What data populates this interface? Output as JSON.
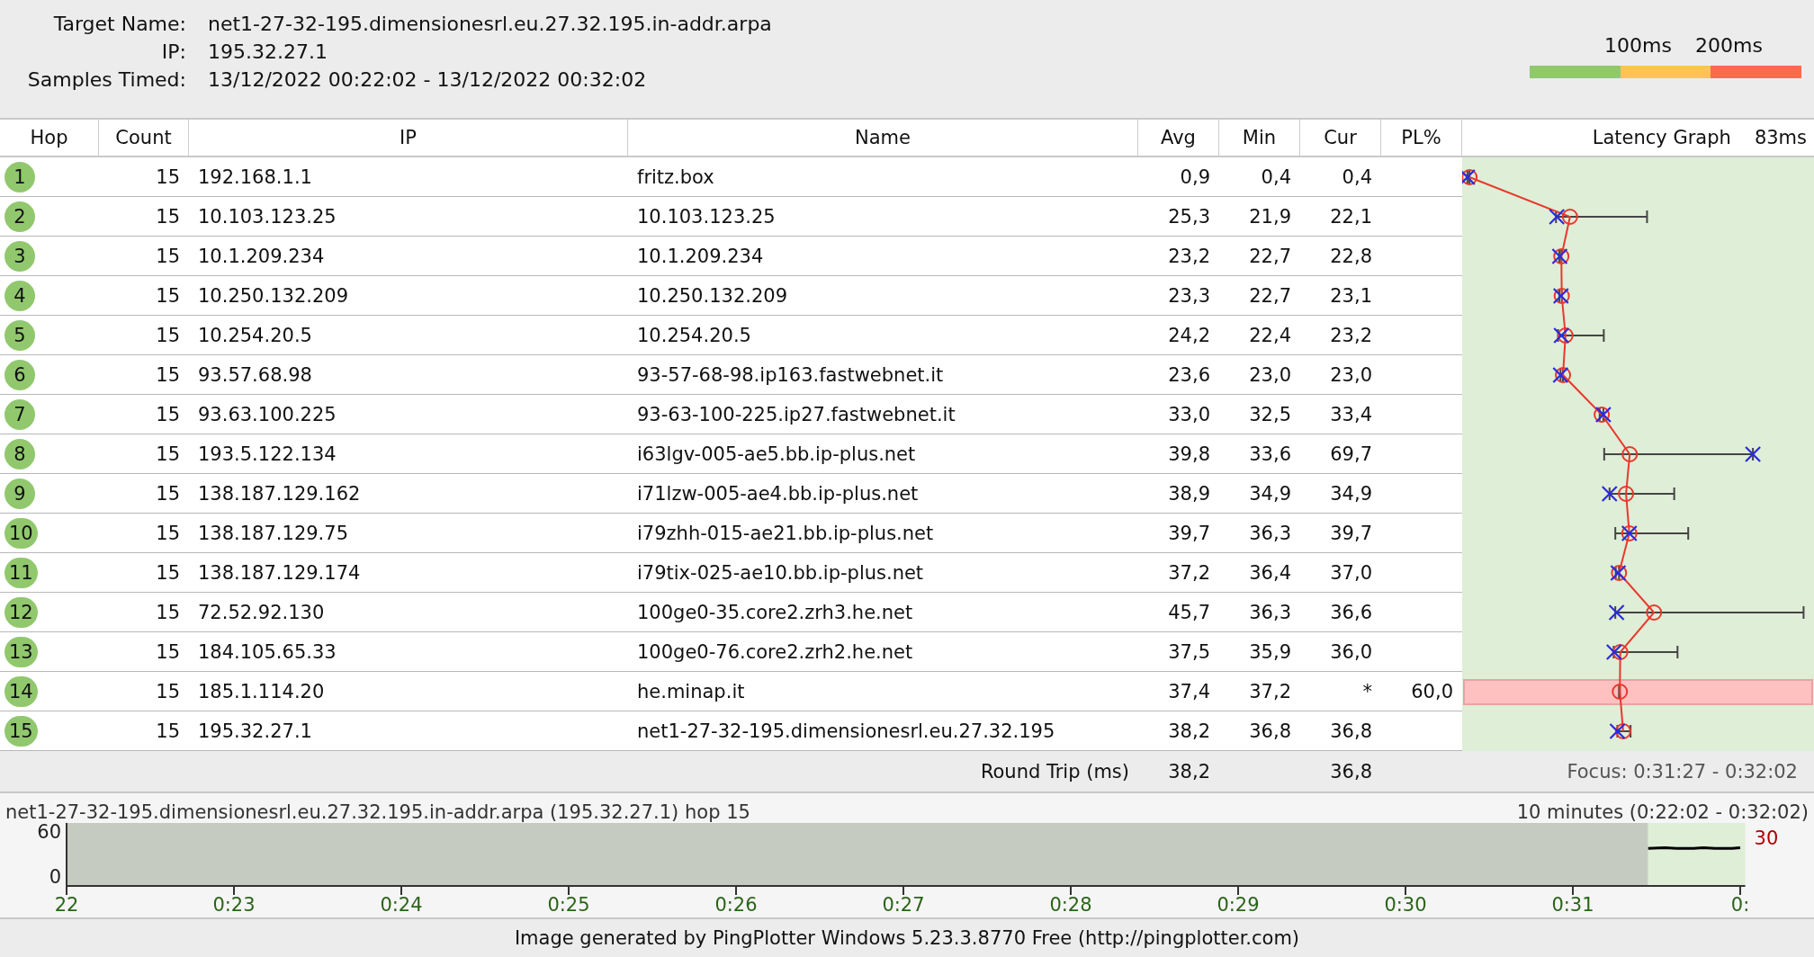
{
  "target": {
    "name_label": "Target Name:",
    "name": "net1-27-32-195.dimensionesrl.eu.27.32.195.in-addr.arpa",
    "ip_label": "IP:",
    "ip": "195.32.27.1",
    "samples_label": "Samples Timed:",
    "samples": "13/12/2022 00:22:02 - 13/12/2022 00:32:02"
  },
  "legend": {
    "labels": [
      "100ms",
      "200ms"
    ],
    "segments": [
      {
        "color": "#90c96a"
      },
      {
        "color": "#fdc454"
      },
      {
        "color": "#fb6a4f"
      }
    ]
  },
  "table": {
    "columns": [
      "Hop",
      "Count",
      "IP",
      "Name",
      "Avg",
      "Min",
      "Cur",
      "PL%"
    ],
    "graph_title": "Latency Graph",
    "graph_scale": "83ms",
    "rows": [
      {
        "hop": "1",
        "count": "15",
        "ip": "192.168.1.1",
        "name": "fritz.box",
        "avg": "0,9",
        "min": "0,4",
        "cur": "0,4"
      },
      {
        "hop": "2",
        "count": "15",
        "ip": "10.103.123.25",
        "name": "10.103.123.25",
        "avg": "25,3",
        "min": "21,9",
        "cur": "22,1"
      },
      {
        "hop": "3",
        "count": "15",
        "ip": "10.1.209.234",
        "name": "10.1.209.234",
        "avg": "23,2",
        "min": "22,7",
        "cur": "22,8"
      },
      {
        "hop": "4",
        "count": "15",
        "ip": "10.250.132.209",
        "name": "10.250.132.209",
        "avg": "23,3",
        "min": "22,7",
        "cur": "23,1"
      },
      {
        "hop": "5",
        "count": "15",
        "ip": "10.254.20.5",
        "name": "10.254.20.5",
        "avg": "24,2",
        "min": "22,4",
        "cur": "23,2"
      },
      {
        "hop": "6",
        "count": "15",
        "ip": "93.57.68.98",
        "name": "93-57-68-98.ip163.fastwebnet.it",
        "avg": "23,6",
        "min": "23,0",
        "cur": "23,0"
      },
      {
        "hop": "7",
        "count": "15",
        "ip": "93.63.100.225",
        "name": "93-63-100-225.ip27.fastwebnet.it",
        "avg": "33,0",
        "min": "32,5",
        "cur": "33,4"
      },
      {
        "hop": "8",
        "count": "15",
        "ip": "193.5.122.134",
        "name": "i63lgv-005-ae5.bb.ip-plus.net",
        "avg": "39,8",
        "min": "33,6",
        "cur": "69,7"
      },
      {
        "hop": "9",
        "count": "15",
        "ip": "138.187.129.162",
        "name": "i71lzw-005-ae4.bb.ip-plus.net",
        "avg": "38,9",
        "min": "34,9",
        "cur": "34,9"
      },
      {
        "hop": "10",
        "count": "15",
        "ip": "138.187.129.75",
        "name": "i79zhh-015-ae21.bb.ip-plus.net",
        "avg": "39,7",
        "min": "36,3",
        "cur": "39,7"
      },
      {
        "hop": "11",
        "count": "15",
        "ip": "138.187.129.174",
        "name": "i79tix-025-ae10.bb.ip-plus.net",
        "avg": "37,2",
        "min": "36,4",
        "cur": "37,0"
      },
      {
        "hop": "12",
        "count": "15",
        "ip": "72.52.92.130",
        "name": "100ge0-35.core2.zrh3.he.net",
        "avg": "45,7",
        "min": "36,3",
        "cur": "36,6"
      },
      {
        "hop": "13",
        "count": "15",
        "ip": "184.105.65.33",
        "name": "100ge0-76.core2.zrh2.he.net",
        "avg": "37,5",
        "min": "35,9",
        "cur": "36,0"
      },
      {
        "hop": "14",
        "count": "15",
        "ip": "185.1.114.20",
        "name": "he.minap.it",
        "avg": "37,4",
        "min": "37,2",
        "cur": "*",
        "pl": "60,0"
      },
      {
        "hop": "15",
        "count": "15",
        "ip": "195.32.27.1",
        "name": "net1-27-32-195.dimensionesrl.eu.27.32.195",
        "avg": "38,2",
        "min": "36,8",
        "cur": "36,8"
      }
    ]
  },
  "round_trip": {
    "label": "Round Trip (ms)",
    "avg": "38,2",
    "cur": "36,8",
    "focus": "Focus: 0:31:27 - 0:32:02"
  },
  "timeline": {
    "host": "net1-27-32-195.dimensionesrl.eu.27.32.195.in-addr.arpa (195.32.27.1) hop 15",
    "range": "10 minutes (0:22:02 - 0:32:02)",
    "current": "30",
    "end_tick_label": "0:",
    "chart_data": {
      "type": "line",
      "xlim": [
        22,
        32.03
      ],
      "ylim": [
        -12,
        72
      ],
      "yticks": [
        0,
        60
      ],
      "xticks": [
        {
          "value": 22,
          "label": "22"
        },
        {
          "value": 23,
          "label": "0:23"
        },
        {
          "value": 24,
          "label": "0:24"
        },
        {
          "value": 25,
          "label": "0:25"
        },
        {
          "value": 26,
          "label": "0:26"
        },
        {
          "value": 27,
          "label": "0:27"
        },
        {
          "value": 28,
          "label": "0:28"
        },
        {
          "value": 29,
          "label": "0:29"
        },
        {
          "value": 30,
          "label": "0:30"
        },
        {
          "value": 31,
          "label": "0:31"
        }
      ],
      "x": [
        31.45,
        31.55,
        31.62,
        31.72,
        31.78,
        31.85,
        31.95,
        32.0
      ],
      "series": [
        {
          "color": "#000000",
          "values": [
            38,
            39,
            38,
            38,
            39,
            38,
            38,
            39
          ]
        }
      ]
    }
  },
  "footer": "Image generated by PingPlotter Windows 5.23.3.8770 Free (http://pingplotter.com)"
}
